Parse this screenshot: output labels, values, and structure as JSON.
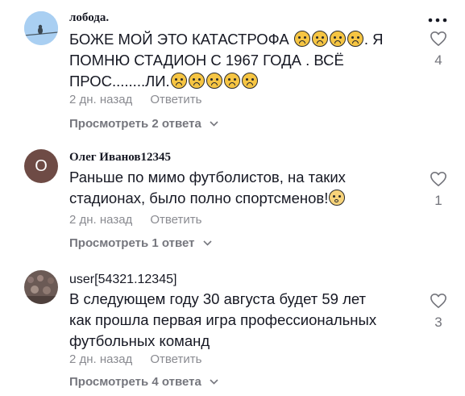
{
  "comments": [
    {
      "author": "лобода.",
      "text_parts": [
        "БОЖЕ МОЙ ЭТО КАТАСТРОФА ",
        ". Я ПОМНЮ СТАДИОН С 1967 ГОДА . ВСЁ ПРОС........ЛИ."
      ],
      "emoji_first_run": 4,
      "emoji_second_run": 5,
      "time": "2 дн. назад",
      "reply_label": "Ответить",
      "view_replies": "Просмотреть 2 ответа",
      "likes": "4"
    },
    {
      "author": "Олег Иванов12345",
      "avatar_letter": "О",
      "text": "Раньше по мимо футболистов, на таких стадионах, было полно спортсменов!",
      "time": "2 дн. назад",
      "reply_label": "Ответить",
      "view_replies": "Просмотреть 1 ответ",
      "likes": "1"
    },
    {
      "author": "user[54321.12345]",
      "text": "В следующем году 30 августа будет 59 лет как прошла первая игра профессиональных футбольных команд",
      "time": "2 дн. назад",
      "reply_label": "Ответить",
      "view_replies": "Просмотреть 4 ответа",
      "likes": "3"
    }
  ],
  "icons": {
    "like": "heart-outline-icon",
    "more": "more-dots-icon",
    "chevron": "chevron-down-icon",
    "emoji": "sad-face-emoji"
  },
  "colors": {
    "text": "#161823",
    "meta": "#8a8b91",
    "replies": "#75767d",
    "avatar_letter_bg": "#6e4b45"
  }
}
